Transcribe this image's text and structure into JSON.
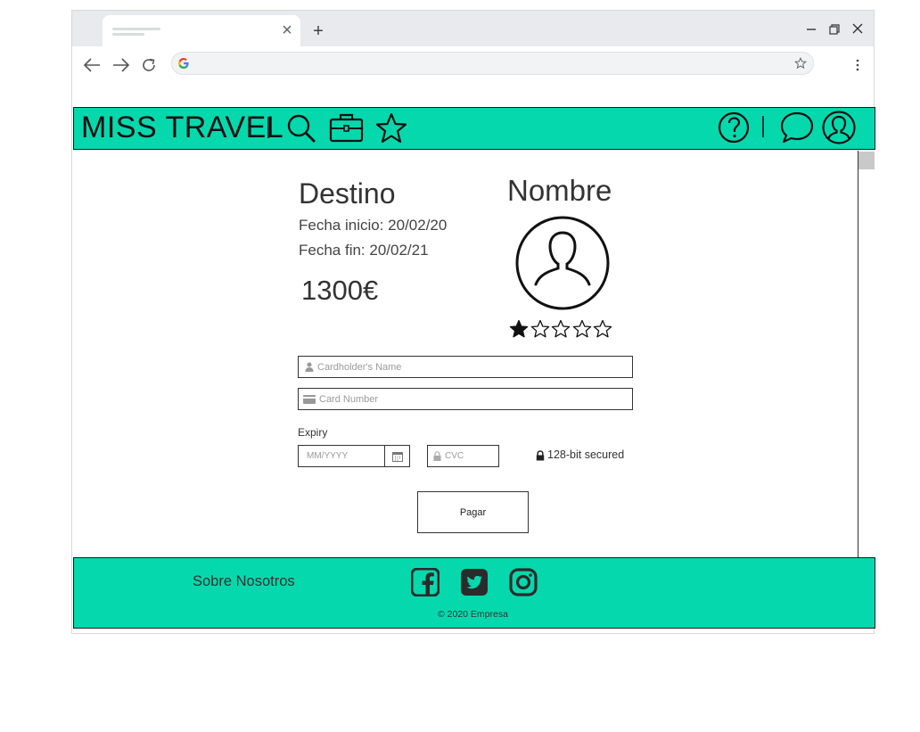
{
  "browser": {
    "new_tab_symbol": "+",
    "close_tab_symbol": "×",
    "window_controls": [
      "minimize-icon",
      "maximize-icon",
      "close-icon"
    ],
    "nav_icons": [
      "back-arrow-icon",
      "forward-arrow-icon",
      "reload-icon"
    ],
    "address_value": "",
    "menu_icon": "kebab-menu-icon"
  },
  "header": {
    "brand": "MISS TRAVEL",
    "left_icons": [
      "search-icon",
      "briefcase-icon",
      "star-icon"
    ],
    "right_icons": [
      "help-icon",
      "chat-icon",
      "user-icon"
    ],
    "background": "#06d8ad"
  },
  "trip": {
    "destination": "Destino",
    "start_date": "Fecha inicio: 20/02/20",
    "end_date": "Fecha fin: 20/02/21",
    "price": "1300€"
  },
  "profile": {
    "name": "Nombre",
    "rating": 1,
    "rating_max": 5
  },
  "payment": {
    "cardholder_placeholder": "Cardholder's Name",
    "card_number_placeholder": "Card Number",
    "expiry_label": "Expiry",
    "expiry_placeholder": "MM/YYYY",
    "cvc_placeholder": "CVC",
    "secured_text": "128-bit secured",
    "pay_button": "Pagar"
  },
  "footer": {
    "about": "Sobre Nosotros",
    "social_icons": [
      "facebook-icon",
      "twitter-icon",
      "instagram-icon"
    ],
    "copyright": "© 2020 Empresa"
  }
}
